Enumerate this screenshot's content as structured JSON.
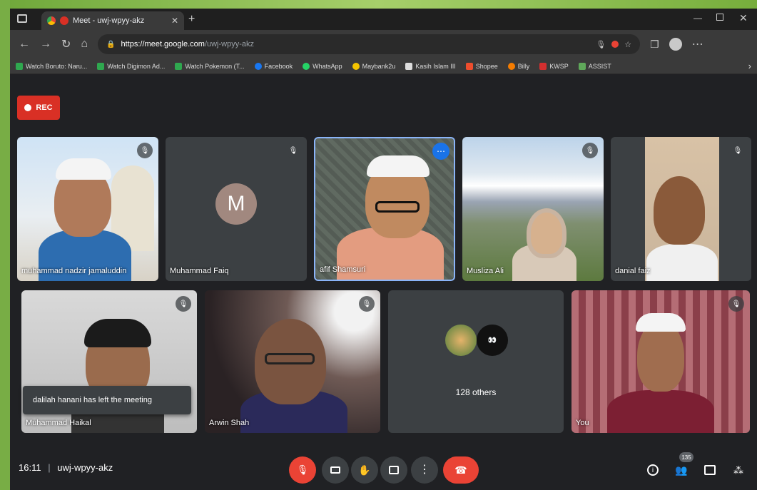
{
  "browser": {
    "tab_title": "Meet - uwj-wpyy-akz",
    "url_host": "https://meet.google.com",
    "url_path": "/uwj-wpyy-akz"
  },
  "bookmarks": [
    {
      "label": "Watch Boruto: Naru...",
      "color": "#2fa84f"
    },
    {
      "label": "Watch Digimon Ad...",
      "color": "#2fa84f"
    },
    {
      "label": "Watch Pokemon (T...",
      "color": "#2fa84f"
    },
    {
      "label": "Facebook",
      "color": "#1877f2"
    },
    {
      "label": "WhatsApp",
      "color": "#25d366"
    },
    {
      "label": "Maybank2u",
      "color": "#f5c400"
    },
    {
      "label": "Kasih Islam III",
      "color": "#dddddd"
    },
    {
      "label": "Shopee",
      "color": "#ee4d2d"
    },
    {
      "label": "Billy",
      "color": "#f57c00"
    },
    {
      "label": "KWSP",
      "color": "#d32f2f"
    },
    {
      "label": "ASSIST",
      "color": "#5fa85a"
    }
  ],
  "rec_label": "REC",
  "participants": [
    {
      "name": "muhammad nadzir jamaluddin"
    },
    {
      "name": "Muhammad Faiq",
      "initial": "M"
    },
    {
      "name": "afif Shamsuri"
    },
    {
      "name": "Musliza Ali"
    },
    {
      "name": "danial faiz"
    },
    {
      "name": "Muhammad Haikal"
    },
    {
      "name": "Arwin Shah"
    },
    {
      "name": "128 others"
    },
    {
      "name": "You"
    }
  ],
  "toast": "dalilah hanani has left the meeting",
  "meeting": {
    "time": "16:11",
    "code": "uwj-wpyy-akz",
    "people_count": "135"
  },
  "colors": {
    "accent": "#8ab4f8",
    "danger": "#ea4335",
    "tile": "#3c4043",
    "bg": "#202124"
  }
}
